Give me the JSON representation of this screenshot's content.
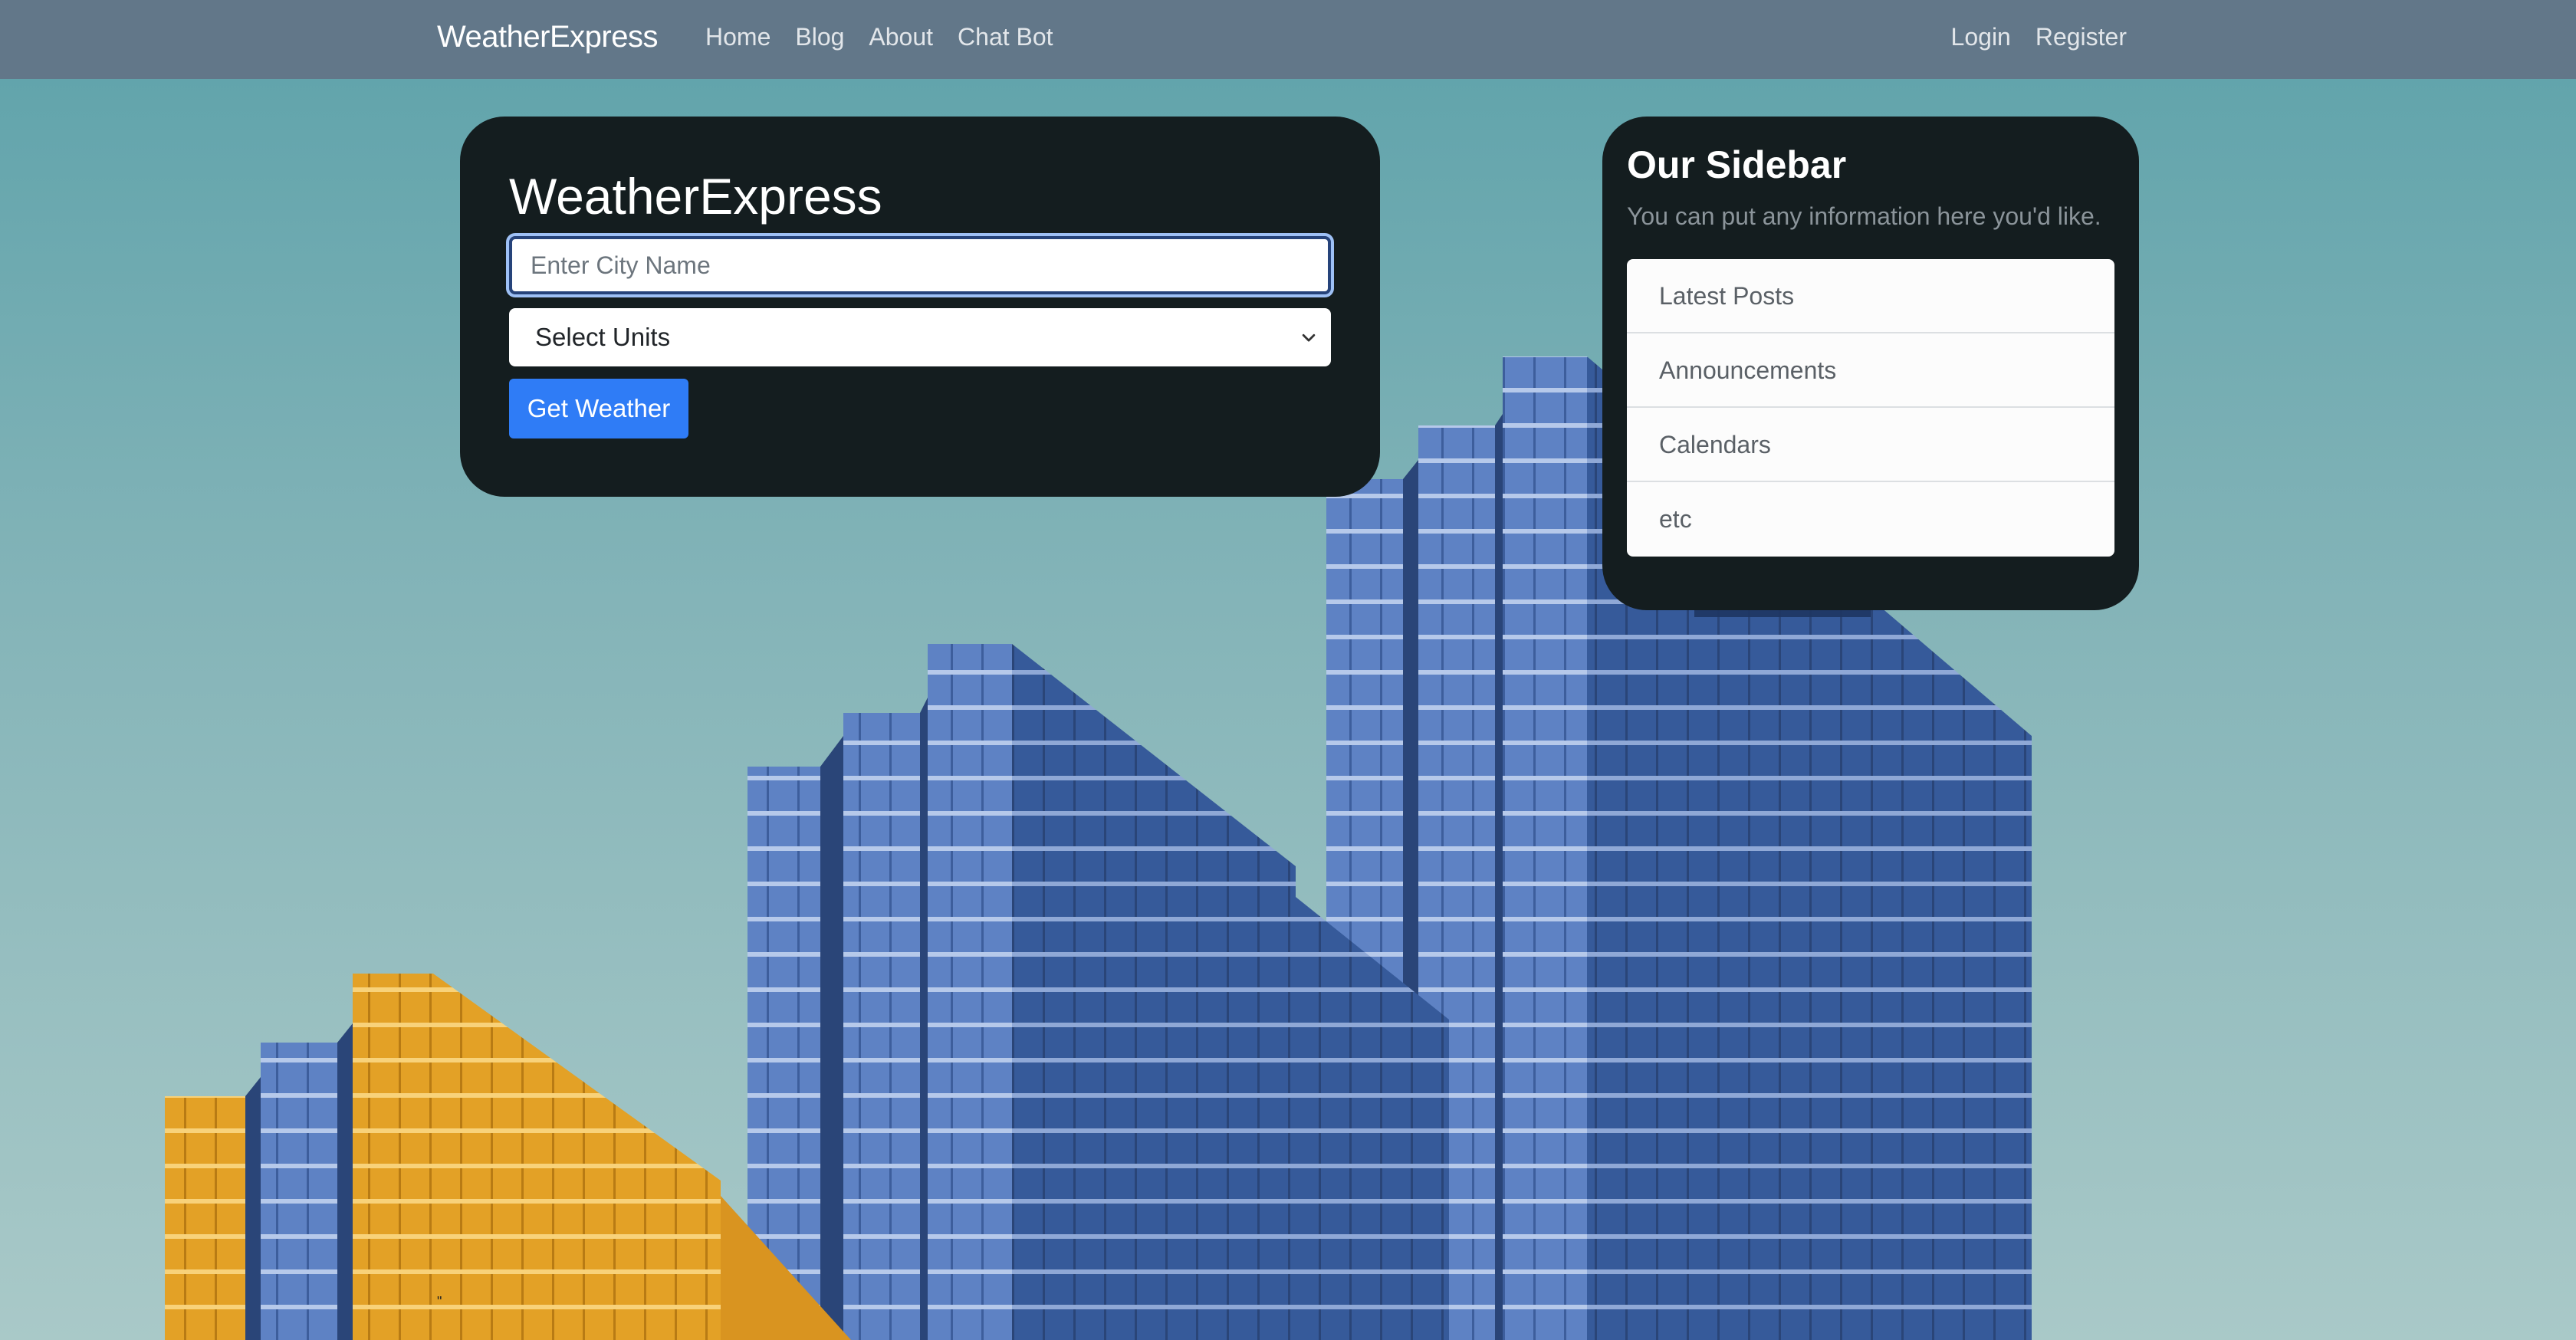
{
  "navbar": {
    "brand": "WeatherExpress",
    "left_links": [
      "Home",
      "Blog",
      "About",
      "Chat Bot"
    ],
    "right_links": [
      "Login",
      "Register"
    ]
  },
  "weather_card": {
    "title": "WeatherExpress",
    "city_placeholder": "Enter City Name",
    "city_value": "",
    "units_selected": "Select Units",
    "button_label": "Get Weather"
  },
  "sidebar": {
    "title": "Our Sidebar",
    "text": "You can put any information here you'd like.",
    "items": [
      "Latest Posts",
      "Announcements",
      "Calendars",
      "etc"
    ]
  },
  "icons": {
    "select_chevron": "chevron-down-icon"
  },
  "colors": {
    "navbar": "#627789",
    "card": "#141d1f",
    "primary": "#2f7cf6",
    "sky_top": "#5da2aa",
    "sky_bottom": "#a9c9c8"
  },
  "footer": {
    "stray_mark": "\""
  }
}
